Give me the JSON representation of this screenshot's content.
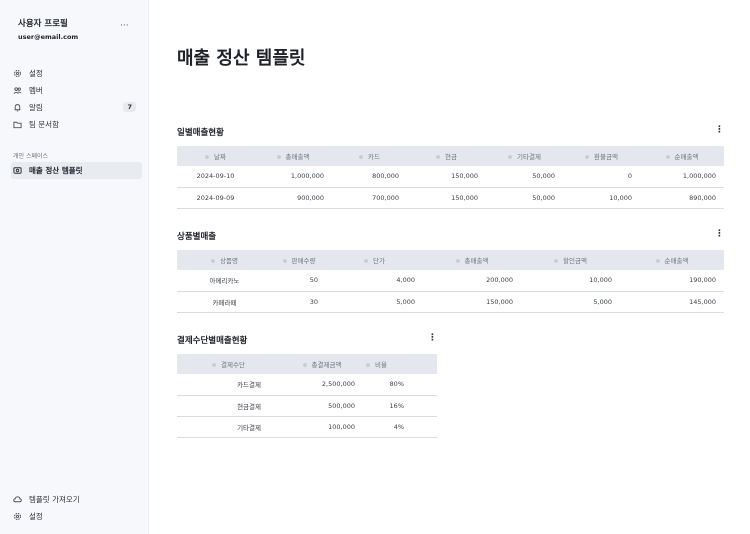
{
  "profile": {
    "name": "사용자 프로필",
    "email": "user@email.com",
    "more": "···"
  },
  "nav": {
    "items": [
      {
        "label": "설정",
        "icon": "gear-icon"
      },
      {
        "label": "멤버",
        "icon": "users-icon"
      },
      {
        "label": "알림",
        "icon": "bell-icon",
        "badge": "7"
      },
      {
        "label": "팀 문서함",
        "icon": "folder-icon"
      }
    ],
    "section_label": "개인 스페이스",
    "active_item": {
      "label": "매출 정산 템플릿",
      "icon": "template-icon"
    },
    "bottom": [
      {
        "label": "템플릿 가져오기",
        "icon": "cloud-download-icon"
      },
      {
        "label": "설정",
        "icon": "gear-icon"
      }
    ]
  },
  "page": {
    "title": "매출 정산 템플릿"
  },
  "tables": {
    "daily": {
      "title": "일별매출현황",
      "headers": [
        "날짜",
        "총매출액",
        "카드",
        "현금",
        "기타결제",
        "환불금액",
        "순매출액"
      ],
      "rows": [
        [
          "2024-09-10",
          "1,000,000",
          "800,000",
          "150,000",
          "50,000",
          "0",
          "1,000,000"
        ],
        [
          "2024-09-09",
          "900,000",
          "700,000",
          "150,000",
          "50,000",
          "10,000",
          "890,000"
        ]
      ]
    },
    "product": {
      "title": "상품별매출",
      "headers": [
        "상품명",
        "판매수량",
        "단가",
        "총매출액",
        "할인금액",
        "순매출액"
      ],
      "rows": [
        [
          "아메리카노",
          "50",
          "4,000",
          "200,000",
          "10,000",
          "190,000"
        ],
        [
          "카페라떼",
          "30",
          "5,000",
          "150,000",
          "5,000",
          "145,000"
        ]
      ]
    },
    "payment": {
      "title": "결제수단별매출현황",
      "headers": [
        "결제수단",
        "총결제금액",
        "비율"
      ],
      "rows": [
        [
          "카드결제",
          "2,500,000",
          "80%"
        ],
        [
          "현금결제",
          "500,000",
          "16%"
        ],
        [
          "기타결제",
          "100,000",
          "4%"
        ]
      ]
    }
  },
  "menu_glyph": "⋮"
}
